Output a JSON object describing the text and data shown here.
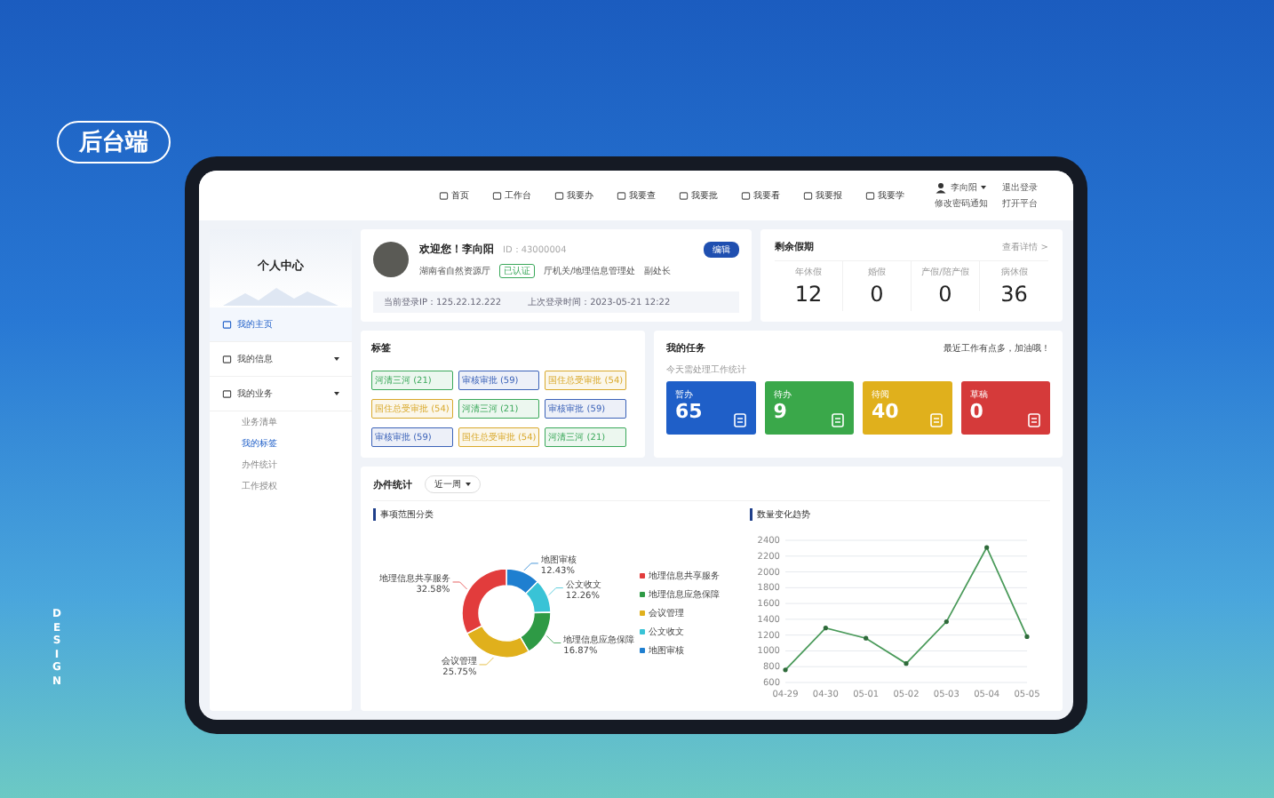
{
  "badge": "后台端",
  "side_word": "DESIGN",
  "nav": {
    "items": [
      {
        "label": "首页"
      },
      {
        "label": "工作台"
      },
      {
        "label": "我要办"
      },
      {
        "label": "我要查"
      },
      {
        "label": "我要批"
      },
      {
        "label": "我要看"
      },
      {
        "label": "我要报"
      },
      {
        "label": "我要学"
      }
    ],
    "user": "李向阳",
    "links": [
      "退出登录",
      "修改密码通知",
      "打开平台"
    ]
  },
  "sidebar": {
    "title": "个人中心",
    "items": [
      {
        "label": "我的主页",
        "kind": "link",
        "selected": true
      },
      {
        "label": "我的信息",
        "kind": "group",
        "selected": false
      },
      {
        "label": "我的业务",
        "kind": "group",
        "selected": false,
        "children": [
          {
            "label": "业务清单",
            "selected": false
          },
          {
            "label": "我的标签",
            "selected": true
          },
          {
            "label": "办件统计",
            "selected": false
          },
          {
            "label": "工作授权",
            "selected": false
          }
        ]
      }
    ]
  },
  "profile": {
    "greeting": "欢迎您！李向阳",
    "id": "ID：43000004",
    "org": "湖南省自然资源厅",
    "verified": "已认证",
    "dept": "厅机关/地理信息管理处",
    "role": "副处长",
    "edit": "编辑",
    "ip": "当前登录IP：125.22.12.222",
    "last_login": "上次登录时间：2023-05-21 12:22"
  },
  "holiday": {
    "title": "剩余假期",
    "more": "查看详情 >",
    "items": [
      {
        "label": "年休假",
        "value": "12"
      },
      {
        "label": "婚假",
        "value": "0"
      },
      {
        "label": "产假/陪产假",
        "value": "0"
      },
      {
        "label": "病休假",
        "value": "36"
      }
    ]
  },
  "tags": {
    "title": "标签",
    "items": [
      {
        "label": "河清三河 (21)",
        "color": "#3aa85a"
      },
      {
        "label": "审核审批 (59)",
        "color": "#3b62b8"
      },
      {
        "label": "国住总受审批 (54)",
        "color": "#d9a92c"
      },
      {
        "label": "国住总受审批 (54)",
        "color": "#d9a92c"
      },
      {
        "label": "河清三河 (21)",
        "color": "#3aa85a"
      },
      {
        "label": "审核审批 (59)",
        "color": "#3b62b8"
      },
      {
        "label": "审核审批 (59)",
        "color": "#3b62b8"
      },
      {
        "label": "国住总受审批 (54)",
        "color": "#d9a92c"
      },
      {
        "label": "河清三河 (21)",
        "color": "#3aa85a"
      }
    ]
  },
  "tasks": {
    "title": "我的任务",
    "note": "最近工作有点多，加油哦！",
    "subtitle": "今天需处理工作统计",
    "cards": [
      {
        "label": "暂办",
        "value": "65",
        "color": "#1f5fc8"
      },
      {
        "label": "待办",
        "value": "9",
        "color": "#3aa84a"
      },
      {
        "label": "待阅",
        "value": "40",
        "color": "#e0b01c"
      },
      {
        "label": "草稿",
        "value": "0",
        "color": "#d53a3a"
      }
    ]
  },
  "stats": {
    "title": "办件统计",
    "period": "近一周",
    "donut": {
      "title": "事项范围分类",
      "chart_data": {
        "type": "donut",
        "categories": [
          "地图审核",
          "公文收文",
          "地理信息应急保障",
          "会议管理",
          "地理信息共享服务"
        ],
        "values": [
          12.43,
          12.26,
          16.87,
          25.75,
          32.58
        ],
        "value_labels": [
          "12.43%",
          "12.26%",
          "16.87%",
          "25.75%",
          "32.58%"
        ],
        "colors": [
          "#1f7fd0",
          "#39c3d6",
          "#2e9a45",
          "#e0b01c",
          "#e23c3c"
        ]
      },
      "legend": [
        {
          "label": "地理信息共享服务",
          "color": "#e23c3c"
        },
        {
          "label": "地理信息应急保障",
          "color": "#2e9a45"
        },
        {
          "label": "会议管理",
          "color": "#e0b01c"
        },
        {
          "label": "公文收文",
          "color": "#39c3d6"
        },
        {
          "label": "地图审核",
          "color": "#1f7fd0"
        }
      ]
    },
    "line": {
      "title": "数量变化趋势",
      "chart_data": {
        "type": "line",
        "categories": [
          "04-29",
          "04-30",
          "05-01",
          "05-02",
          "05-03",
          "05-04",
          "05-05"
        ],
        "series": [
          {
            "color": "#4a9a5a",
            "values": [
              760,
              1290,
              1160,
              840,
              1370,
              2310,
              1180
            ]
          }
        ],
        "grid": true,
        "ylim": [
          600,
          2400
        ],
        "yticks": [
          600,
          800,
          1000,
          1200,
          1400,
          1600,
          1800,
          2000,
          2200,
          2400
        ]
      }
    }
  }
}
